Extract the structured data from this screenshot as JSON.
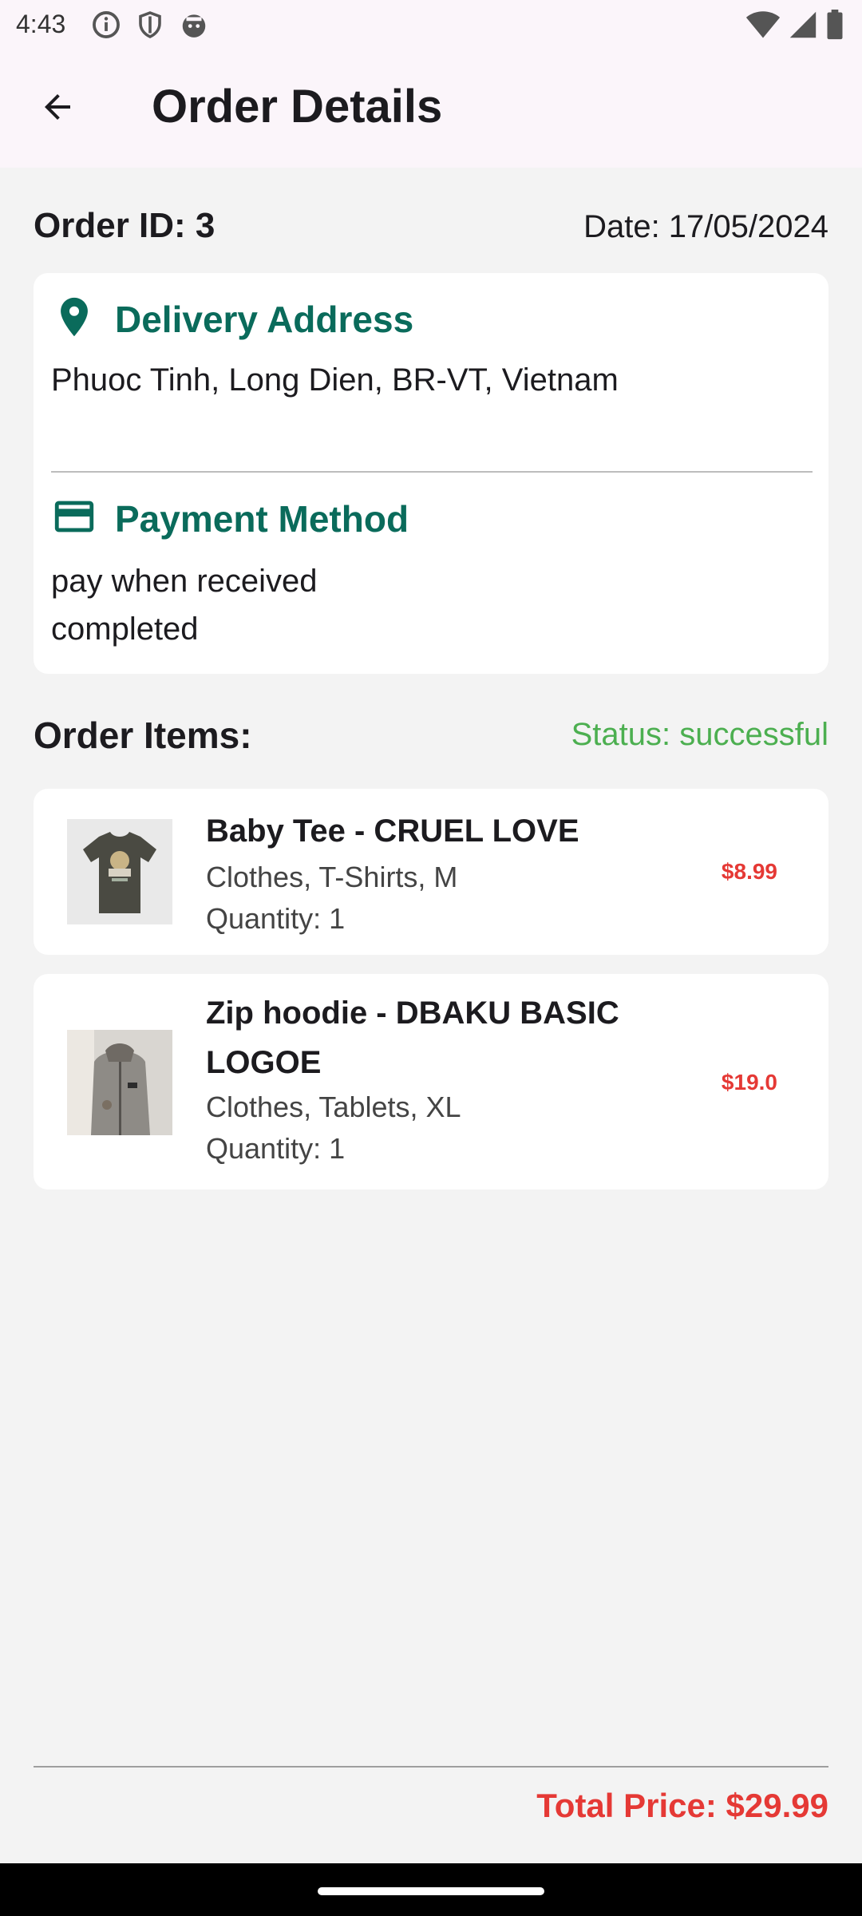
{
  "status_bar": {
    "time": "4:43",
    "left_icons": [
      "info-circle-icon",
      "shield-icon",
      "android-face-icon"
    ],
    "right_icons": [
      "wifi-icon",
      "signal-icon",
      "battery-icon"
    ]
  },
  "header": {
    "title": "Order Details",
    "back_icon": "arrow-back-icon"
  },
  "order": {
    "id_label": "Order ID: 3",
    "date_label": "Date: 17/05/2024"
  },
  "delivery": {
    "icon": "location-pin-icon",
    "title": "Delivery Address",
    "address": "Phuoc Tinh, Long Dien, BR-VT, Vietnam"
  },
  "payment": {
    "icon": "credit-card-icon",
    "title": "Payment Method",
    "method": "pay when received",
    "state": "completed"
  },
  "items_section": {
    "title": "Order Items:",
    "status": "Status: successful"
  },
  "items": [
    {
      "name": "Baby Tee - CRUEL LOVE",
      "details": "Clothes, T-Shirts, M",
      "quantity": "Quantity: 1",
      "price": "$8.99"
    },
    {
      "name": "Zip hoodie - DBAKU BASIC LOGOE",
      "details": "Clothes, Tablets, XL",
      "quantity": "Quantity: 1",
      "price": "$19.0"
    }
  ],
  "footer": {
    "total": "Total Price: $29.99"
  },
  "colors": {
    "accent_teal": "#0a6b5b",
    "price_red": "#e53935",
    "status_green": "#4caf50",
    "app_bar_bg": "#fbf5fa"
  }
}
